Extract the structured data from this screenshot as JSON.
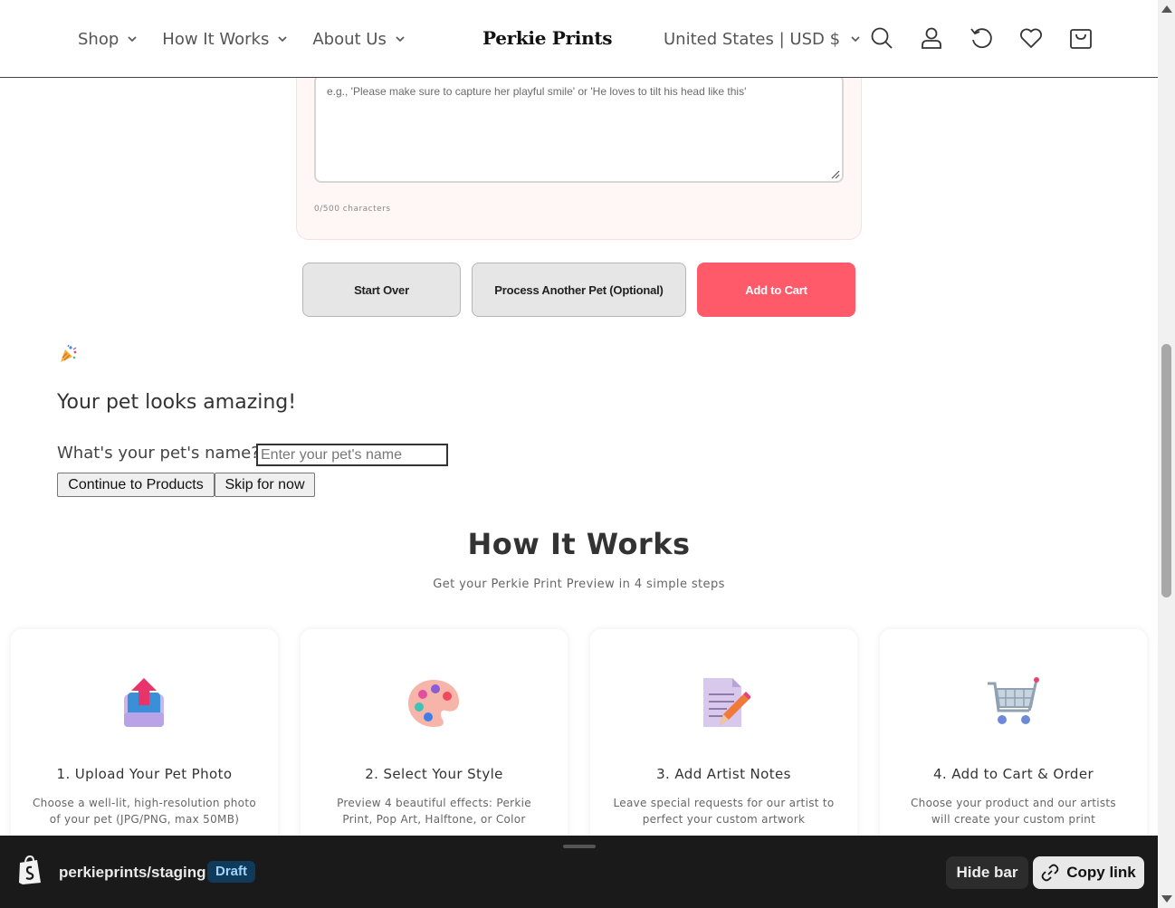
{
  "header": {
    "nav": [
      {
        "label": "Shop"
      },
      {
        "label": "How It Works"
      },
      {
        "label": "About Us"
      }
    ],
    "brand": "Perkie Prints",
    "currency": "United States | USD $",
    "icons": [
      "search-icon",
      "account-icon",
      "history-icon",
      "wishlist-icon",
      "cart-icon"
    ]
  },
  "notes": {
    "placeholder": "e.g., 'Please make sure to capture her playful smile' or 'He loves to tilt his head like this'",
    "char_count": "0/500 characters"
  },
  "actions": {
    "start_over": "Start Over",
    "process_another": "Process Another Pet (Optional)",
    "add_to_cart": "Add to Cart"
  },
  "success": {
    "icon": "party-popper-icon",
    "title": "Your pet looks amazing!",
    "name_label": "What's your pet's name?",
    "name_placeholder": "Enter your pet's name",
    "continue": "Continue to Products",
    "skip": "Skip for now"
  },
  "how_it_works": {
    "title": "How It Works",
    "subtitle": "Get your Perkie Print Preview in 4 simple steps",
    "steps": [
      {
        "icon": "upload-icon",
        "title": "1. Upload Your Pet Photo",
        "desc": "Choose a well-lit, high-resolution photo of your pet (JPG/PNG, max 50MB)"
      },
      {
        "icon": "palette-icon",
        "title": "2. Select Your Style",
        "desc": "Preview 4 beautiful effects: Perkie Print, Pop Art, Halftone, or Color"
      },
      {
        "icon": "notes-icon",
        "title": "3. Add Artist Notes",
        "desc": "Leave special requests for our artist to perfect your custom artwork"
      },
      {
        "icon": "shopping-cart-icon",
        "title": "4. Add to Cart & Order",
        "desc": "Choose your product and our artists will create your custom print"
      }
    ]
  },
  "preview_bar": {
    "store": "perkieprints/staging",
    "badge": "Draft",
    "hide": "Hide bar",
    "copy": "Copy link"
  },
  "colors": {
    "accent": "#fe5a6a",
    "bar_bg": "#1a1a1a",
    "badge_bg": "#0f3a5a"
  }
}
